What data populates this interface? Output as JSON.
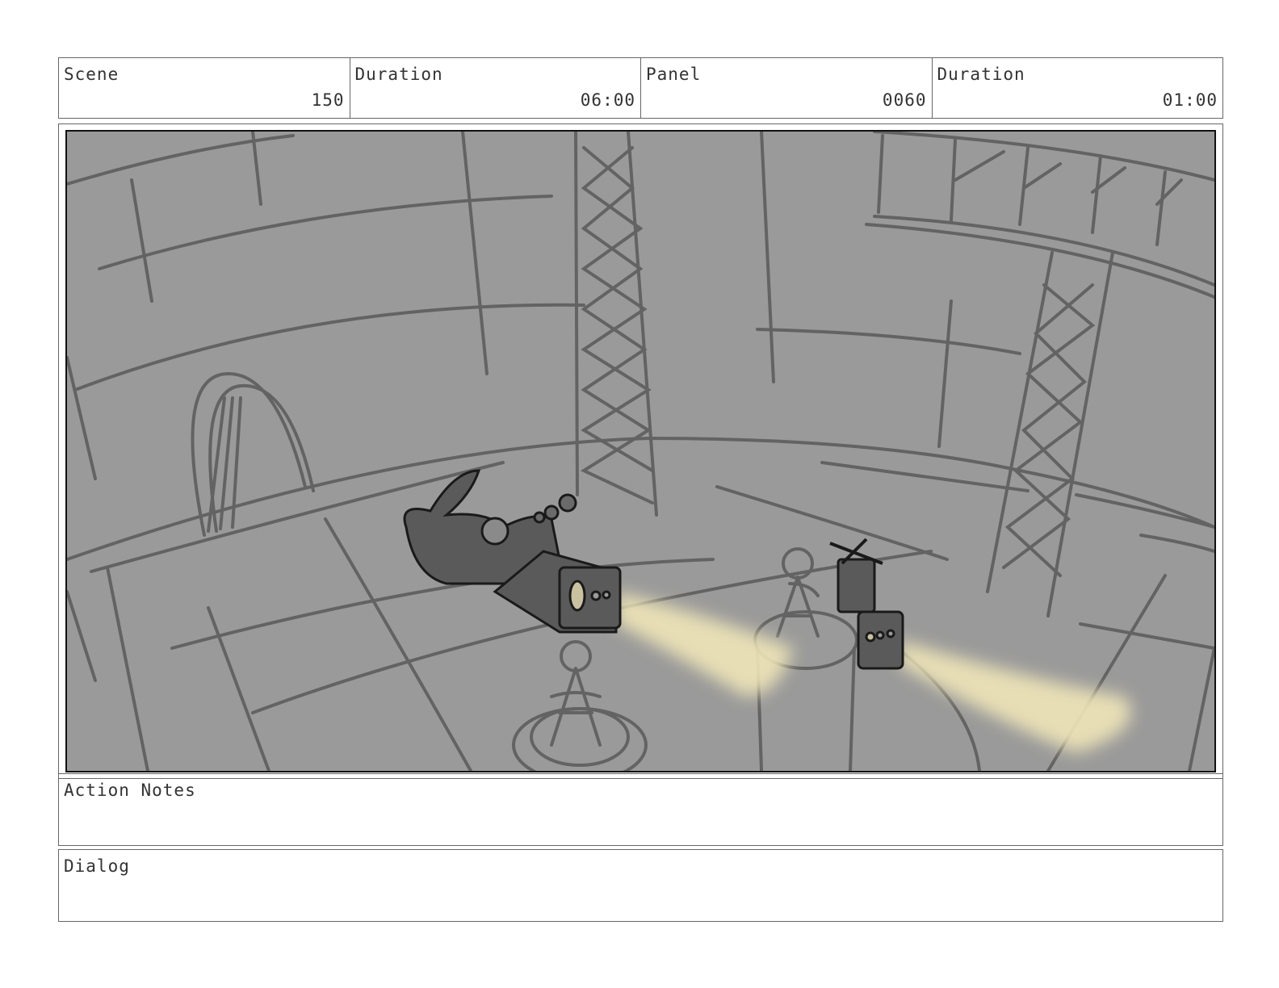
{
  "header": {
    "scene_label": "Scene",
    "scene_value": "150",
    "scene_duration_label": "Duration",
    "scene_duration_value": "06:00",
    "panel_label": "Panel",
    "panel_value": "0060",
    "panel_duration_label": "Duration",
    "panel_duration_value": "01:00"
  },
  "notes": {
    "action_label": "Action Notes",
    "dialog_label": "Dialog"
  },
  "colors": {
    "panel_bg": "#9a9a9a",
    "sketch_line": "#636363",
    "headlight_beam": "#efe5b8"
  }
}
